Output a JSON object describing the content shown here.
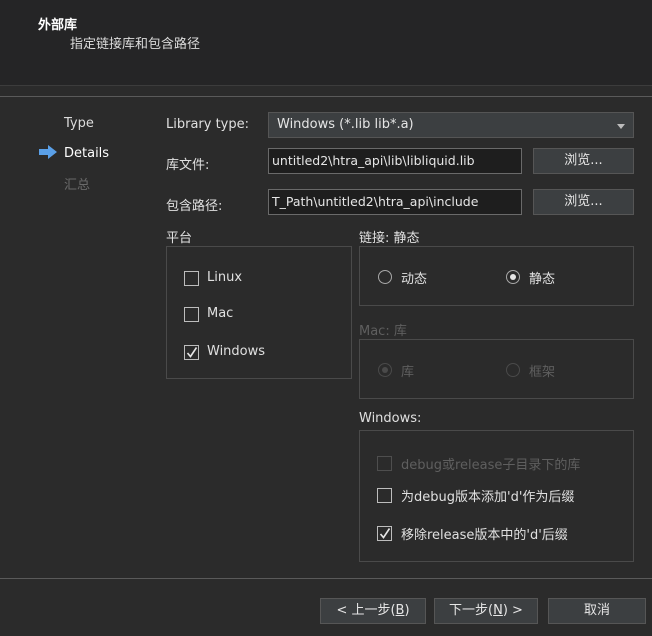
{
  "header": {
    "title": "外部库",
    "subtitle": "指定链接库和包含路径"
  },
  "steps": [
    {
      "label": "Type",
      "state": "done"
    },
    {
      "label": "Details",
      "state": "current"
    },
    {
      "label": "汇总",
      "state": "pending"
    }
  ],
  "form": {
    "library_type_label": "Library type:",
    "library_type_value": "Windows (*.lib lib*.a)",
    "lib_file_label": "库文件:",
    "lib_file_value": "untitled2\\htra_api\\lib\\libliquid.lib",
    "include_label": "包含路径:",
    "include_value": "T_Path\\untitled2\\htra_api\\include",
    "browse_label": "浏览..."
  },
  "platform": {
    "title": "平台",
    "options": [
      {
        "label": "Linux",
        "checked": false
      },
      {
        "label": "Mac",
        "checked": false
      },
      {
        "label": "Windows",
        "checked": true
      }
    ]
  },
  "linkage": {
    "title": "链接: 静态",
    "dynamic_label": "动态",
    "static_label": "静态",
    "selected": "static"
  },
  "mac": {
    "title": "Mac: 库",
    "lib_label": "库",
    "framework_label": "框架",
    "enabled": false
  },
  "windows": {
    "title": "Windows:",
    "options": [
      {
        "label": "debug或release子目录下的库",
        "checked": false,
        "enabled": false
      },
      {
        "label": "为debug版本添加'd'作为后缀",
        "checked": false,
        "enabled": true
      },
      {
        "label": "移除release版本中的'd'后缀",
        "checked": true,
        "enabled": true
      }
    ]
  },
  "footer": {
    "back_prefix": "< 上一步(",
    "back_key": "B",
    "back_suffix": ")",
    "next_prefix": "下一步(",
    "next_key": "N",
    "next_suffix": ") >",
    "cancel_label": "取消"
  },
  "colors": {
    "background": "#2b2b2b",
    "accent_arrow": "#5aa0e8",
    "disabled_text": "#5f5f5f"
  }
}
